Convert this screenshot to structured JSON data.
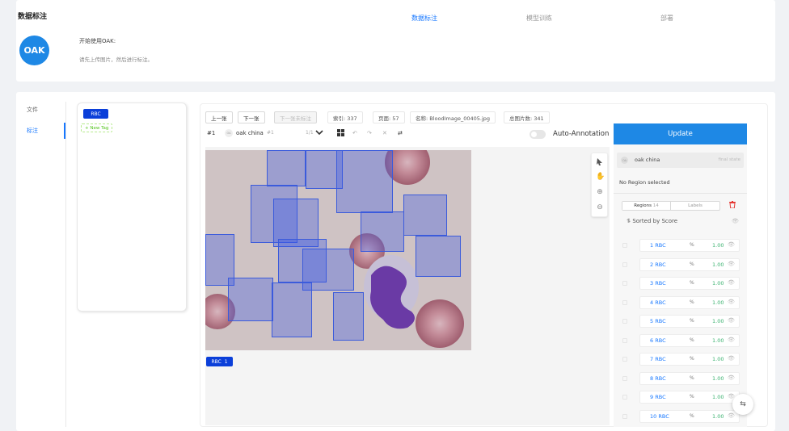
{
  "header": {
    "app_title": "数据标注",
    "nav": [
      {
        "label": "数据标注",
        "active": true
      },
      {
        "label": "模型训练",
        "active": false
      },
      {
        "label": "部署",
        "active": false
      }
    ],
    "logo_text": "OAK",
    "intro_title": "开始使用OAK:",
    "intro_sub": "请先上传图片，然后进行标注。"
  },
  "side_menu": [
    {
      "label": "文件",
      "active": false
    },
    {
      "label": "标注",
      "active": true
    }
  ],
  "tags": {
    "items": [
      {
        "label": "RBC",
        "color": "#0b3fd9"
      }
    ],
    "new_tag_label": "+ New Tag"
  },
  "toolbar": {
    "prev": "上一张",
    "next": "下一张",
    "next_unlabeled": "下一张未标注",
    "index": "索引: 337",
    "page": "页面: 57",
    "filename": "名称: BloodImage_00405.jpg",
    "total": "总图片数: 341"
  },
  "tool_row": {
    "hash": "#1",
    "user": "oak china",
    "user_suffix": "#1",
    "counter": "1/1",
    "auto_annotation": "Auto-Annotation"
  },
  "canvas": {
    "label_tag": "RBC",
    "label_count": "1"
  },
  "right_panel": {
    "update_label": "Update",
    "user_avatar": "OA",
    "user_name": "oak china",
    "state": "final state",
    "no_region": "No Region selected",
    "tab_regions": "Regions",
    "tab_regions_count": "14",
    "tab_labels": "Labels",
    "sorted_by": "Sorted by Score",
    "regions": [
      {
        "num": "1",
        "label": "RBC",
        "pct": "%",
        "score": "1.00"
      },
      {
        "num": "2",
        "label": "RBC",
        "pct": "%",
        "score": "1.00"
      },
      {
        "num": "3",
        "label": "RBC",
        "pct": "%",
        "score": "1.00"
      },
      {
        "num": "4",
        "label": "RBC",
        "pct": "%",
        "score": "1.00"
      },
      {
        "num": "5",
        "label": "RBC",
        "pct": "%",
        "score": "1.00"
      },
      {
        "num": "6",
        "label": "RBC",
        "pct": "%",
        "score": "1.00"
      },
      {
        "num": "7",
        "label": "RBC",
        "pct": "%",
        "score": "1.00"
      },
      {
        "num": "8",
        "label": "RBC",
        "pct": "%",
        "score": "1.00"
      },
      {
        "num": "9",
        "label": "RBC",
        "pct": "%",
        "score": "1.00"
      },
      {
        "num": "10",
        "label": "RBC",
        "pct": "%",
        "score": "1.00"
      }
    ]
  },
  "colors": {
    "accent": "#1677ff",
    "update_button": "#1e88e5",
    "tag_blue": "#0b3fd9",
    "score_green": "#3cb371",
    "delete_red": "#e53935"
  },
  "icons": [
    "grid-icon",
    "undo-icon",
    "redo-icon",
    "close-icon",
    "swap-icon",
    "pointer-icon",
    "pan-icon",
    "zoom-in-icon",
    "zoom-out-icon",
    "trash-icon",
    "sort-icon",
    "eye-icon",
    "swap-fab-icon"
  ]
}
